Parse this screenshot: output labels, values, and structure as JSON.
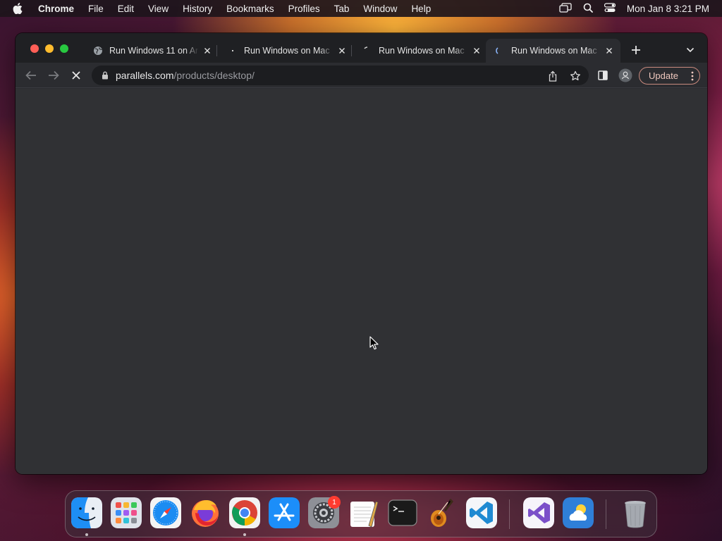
{
  "menubar": {
    "app_name": "Chrome",
    "items": [
      "File",
      "Edit",
      "View",
      "History",
      "Bookmarks",
      "Profiles",
      "Tab",
      "Window",
      "Help"
    ],
    "clock": "Mon Jan 8  3:21 PM"
  },
  "browser": {
    "tabs": [
      {
        "title": "Run Windows 11 on Ar",
        "favicon": "globe-icon",
        "active": false
      },
      {
        "title": "Run Windows on Mac",
        "favicon": "parallels-icon",
        "active": false
      },
      {
        "title": "Run Windows on Mac",
        "favicon": "parallels-icon",
        "active": false
      },
      {
        "title": "Run Windows on Mac",
        "favicon": "loading-icon",
        "active": true
      }
    ],
    "url": {
      "host": "parallels.com",
      "path": "/products/desktop/"
    },
    "update_label": "Update"
  },
  "dock": {
    "apps": [
      "finder",
      "launchpad",
      "safari",
      "firefox",
      "chrome",
      "app-store",
      "system-settings",
      "textedit",
      "terminal",
      "garageband",
      "vscode",
      "visual-studio",
      "weather",
      "trash"
    ],
    "system_settings_badge": "1"
  },
  "colors": {
    "window_bg": "#2b2c30",
    "content_bg": "#303134",
    "update_accent": "#c98a7e"
  }
}
